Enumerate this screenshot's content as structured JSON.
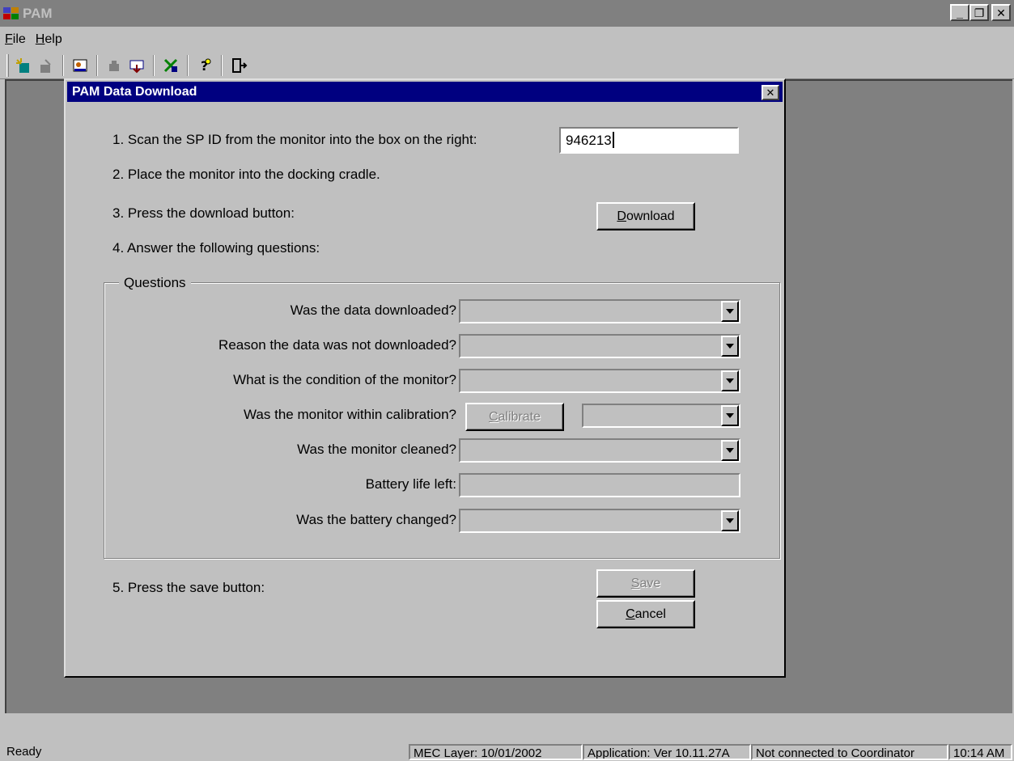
{
  "app": {
    "title": "PAM",
    "window_buttons": {
      "minimize": "_",
      "maximize": "❐",
      "close": "✕"
    }
  },
  "menu": {
    "file": {
      "accel": "F",
      "rest": "ile"
    },
    "help": {
      "accel": "H",
      "rest": "elp"
    }
  },
  "toolbar": {
    "icons": [
      "new-icon",
      "open-icon",
      "user-edit-icon",
      "record-icon",
      "download-icon",
      "equipment-icon",
      "help-icon",
      "exit-icon"
    ]
  },
  "dialog": {
    "title": "PAM Data Download",
    "close_glyph": "✕",
    "step1": "1. Scan the SP ID from the monitor into the box on the right:",
    "spid_value": "946213",
    "step2": "2. Place the monitor into the docking cradle.",
    "step3": "3. Press the download button:",
    "download_button": {
      "accel": "D",
      "rest": "ownload"
    },
    "step4": "4. Answer the following questions:",
    "group_label": "Questions",
    "questions": {
      "downloaded": "Was the data downloaded?",
      "reason": "Reason the data was not downloaded?",
      "condition": "What is the condition of the monitor?",
      "calibration": "Was the monitor within calibration?",
      "cleaned": "Was the monitor cleaned?",
      "battery_life": "Battery life left:",
      "battery_changed": "Was the battery changed?"
    },
    "calibrate_button": {
      "accel": "C",
      "rest": "alibrate"
    },
    "step5": "5. Press the save button:",
    "save_button": {
      "accel": "S",
      "rest": "ave"
    },
    "cancel_button": {
      "accel": "C",
      "rest": "ancel"
    }
  },
  "status": {
    "ready": "Ready",
    "mec_layer": "MEC Layer: 10/01/2002",
    "application": "Application: Ver 10.11.27A",
    "coordinator": "Not connected to Coordinator",
    "time": "10:14 AM"
  }
}
